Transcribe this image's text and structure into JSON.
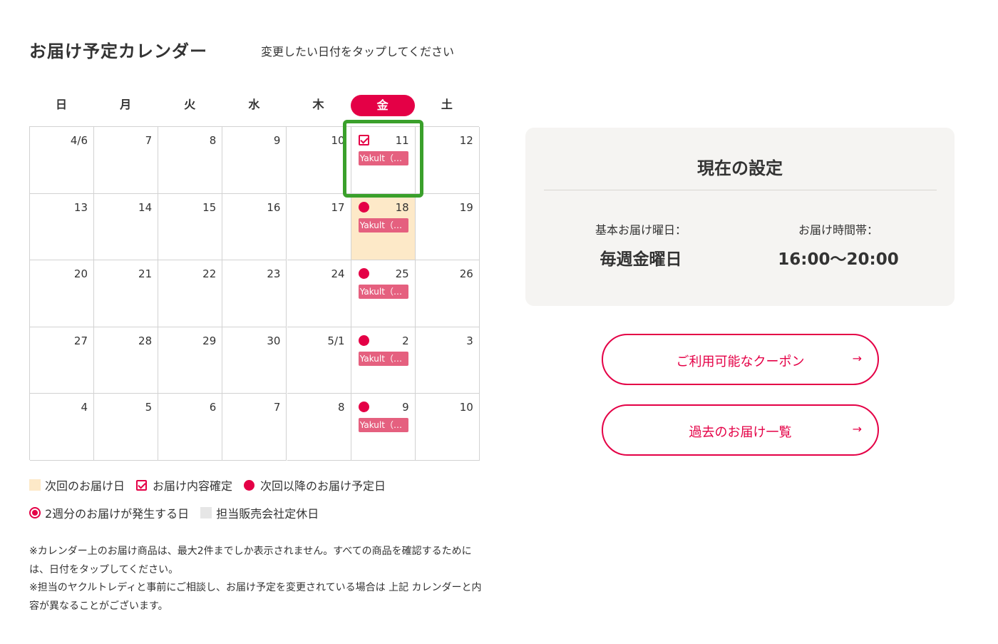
{
  "header": {
    "title": "お届け予定カレンダー",
    "hint": "変更したい日付をタップしてください"
  },
  "calendar": {
    "weekdays": [
      "日",
      "月",
      "火",
      "水",
      "木",
      "金",
      "土"
    ],
    "active_weekday": "金",
    "weeks": [
      [
        "4/6",
        "7",
        "8",
        "9",
        "10",
        "11",
        "12"
      ],
      [
        "13",
        "14",
        "15",
        "16",
        "17",
        "18",
        "19"
      ],
      [
        "20",
        "21",
        "22",
        "23",
        "24",
        "25",
        "26"
      ],
      [
        "27",
        "28",
        "29",
        "30",
        "5/1",
        "2",
        "3"
      ],
      [
        "4",
        "5",
        "6",
        "7",
        "8",
        "9",
        "10"
      ]
    ],
    "delivery_tag": "Yakult（…",
    "confirmed_date": "11",
    "next_delivery_date": "18",
    "scheduled_dates": [
      "18",
      "25",
      "2",
      "9"
    ]
  },
  "legend": {
    "next_delivery": "次回のお届け日",
    "confirmed": "お届け内容確定",
    "scheduled": "次回以降のお届け予定日",
    "double": "2週分のお届けが発生する日",
    "holiday": "担当販売会社定休日"
  },
  "notes": {
    "note1": "※カレンダー上のお届け商品は、最大2件までしか表示されません。すべての商品を確認するためには、日付をタップしてください。",
    "note2": "※担当のヤクルトレディと事前にご相談し、お届け予定を変更されている場合は 上記 カレンダーと内容が異なることがございます。"
  },
  "settings": {
    "title": "現在の設定",
    "weekday_label": "基本お届け曜日：",
    "weekday_value": "毎週金曜日",
    "time_label": "お届け時間帯：",
    "time_value": "16:00〜20:00"
  },
  "buttons": {
    "coupons": "ご利用可能なクーポン",
    "history": "過去のお届け一覧",
    "arrow": "→"
  },
  "colors": {
    "accent": "#e40046",
    "tag": "#e5607f",
    "next_delivery_bg": "#fde9c8",
    "highlight": "#3aa02b",
    "panel_bg": "#f5f4f2"
  }
}
